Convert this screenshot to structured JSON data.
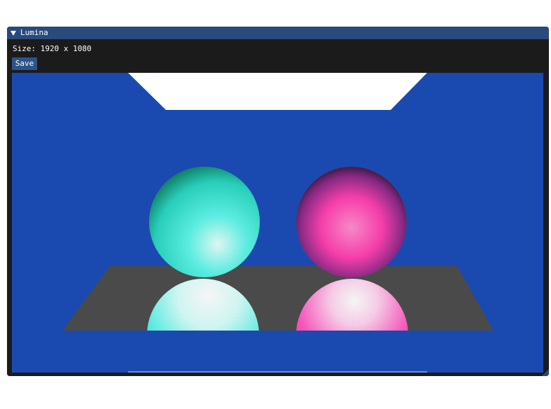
{
  "window": {
    "title": "Lumina"
  },
  "panel": {
    "size_label": "Size: 1920 x 1080",
    "save_label": "Save"
  },
  "colors": {
    "title_bar": "#294a7a",
    "button": "#2c5488",
    "background_wall": "#1a4ab0",
    "floor": "#4a4a4a",
    "light": "#ffffff",
    "cyan_sphere": "#40f0e0",
    "magenta_sphere": "#ff3fa8"
  }
}
